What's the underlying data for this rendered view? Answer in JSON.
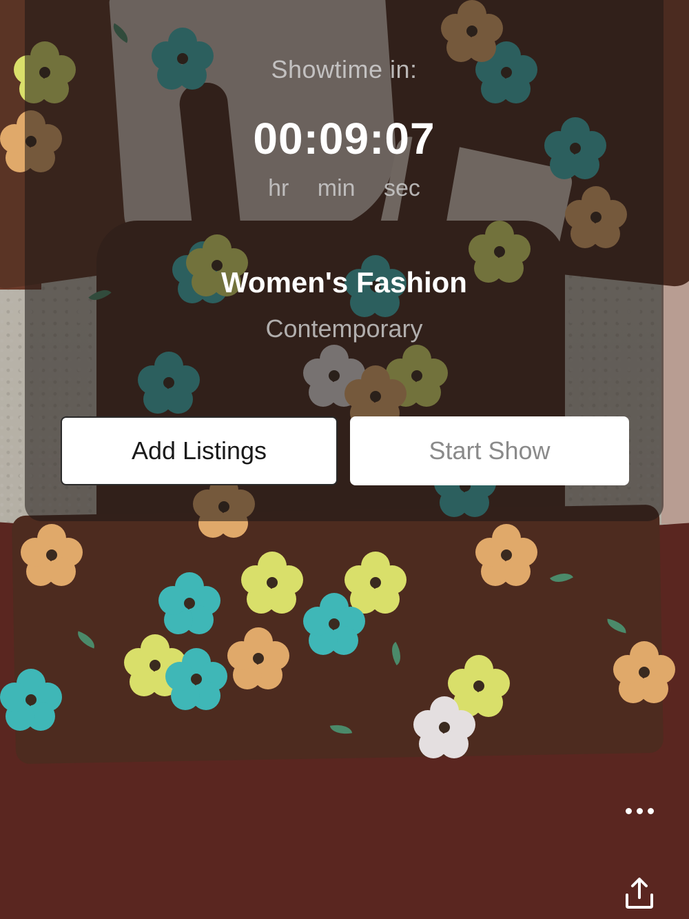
{
  "countdown": {
    "label": "Showtime in:",
    "time": "00:09:07",
    "units": {
      "hr": "hr",
      "min": "min",
      "sec": "sec"
    }
  },
  "show": {
    "category": "Women's Fashion",
    "subcategory": "Contemporary"
  },
  "actions": {
    "add_listings_label": "Add Listings",
    "start_show_label": "Start Show",
    "start_show_enabled": false
  },
  "icons": {
    "more": "more-horizontal-icon",
    "share": "share-upload-icon"
  },
  "colors": {
    "overlay": "#1e1816",
    "button_bg": "#ffffff",
    "button_text": "#1a1a1a",
    "button_disabled_text": "#8a8a8a",
    "countdown_text": "#ffffff"
  }
}
